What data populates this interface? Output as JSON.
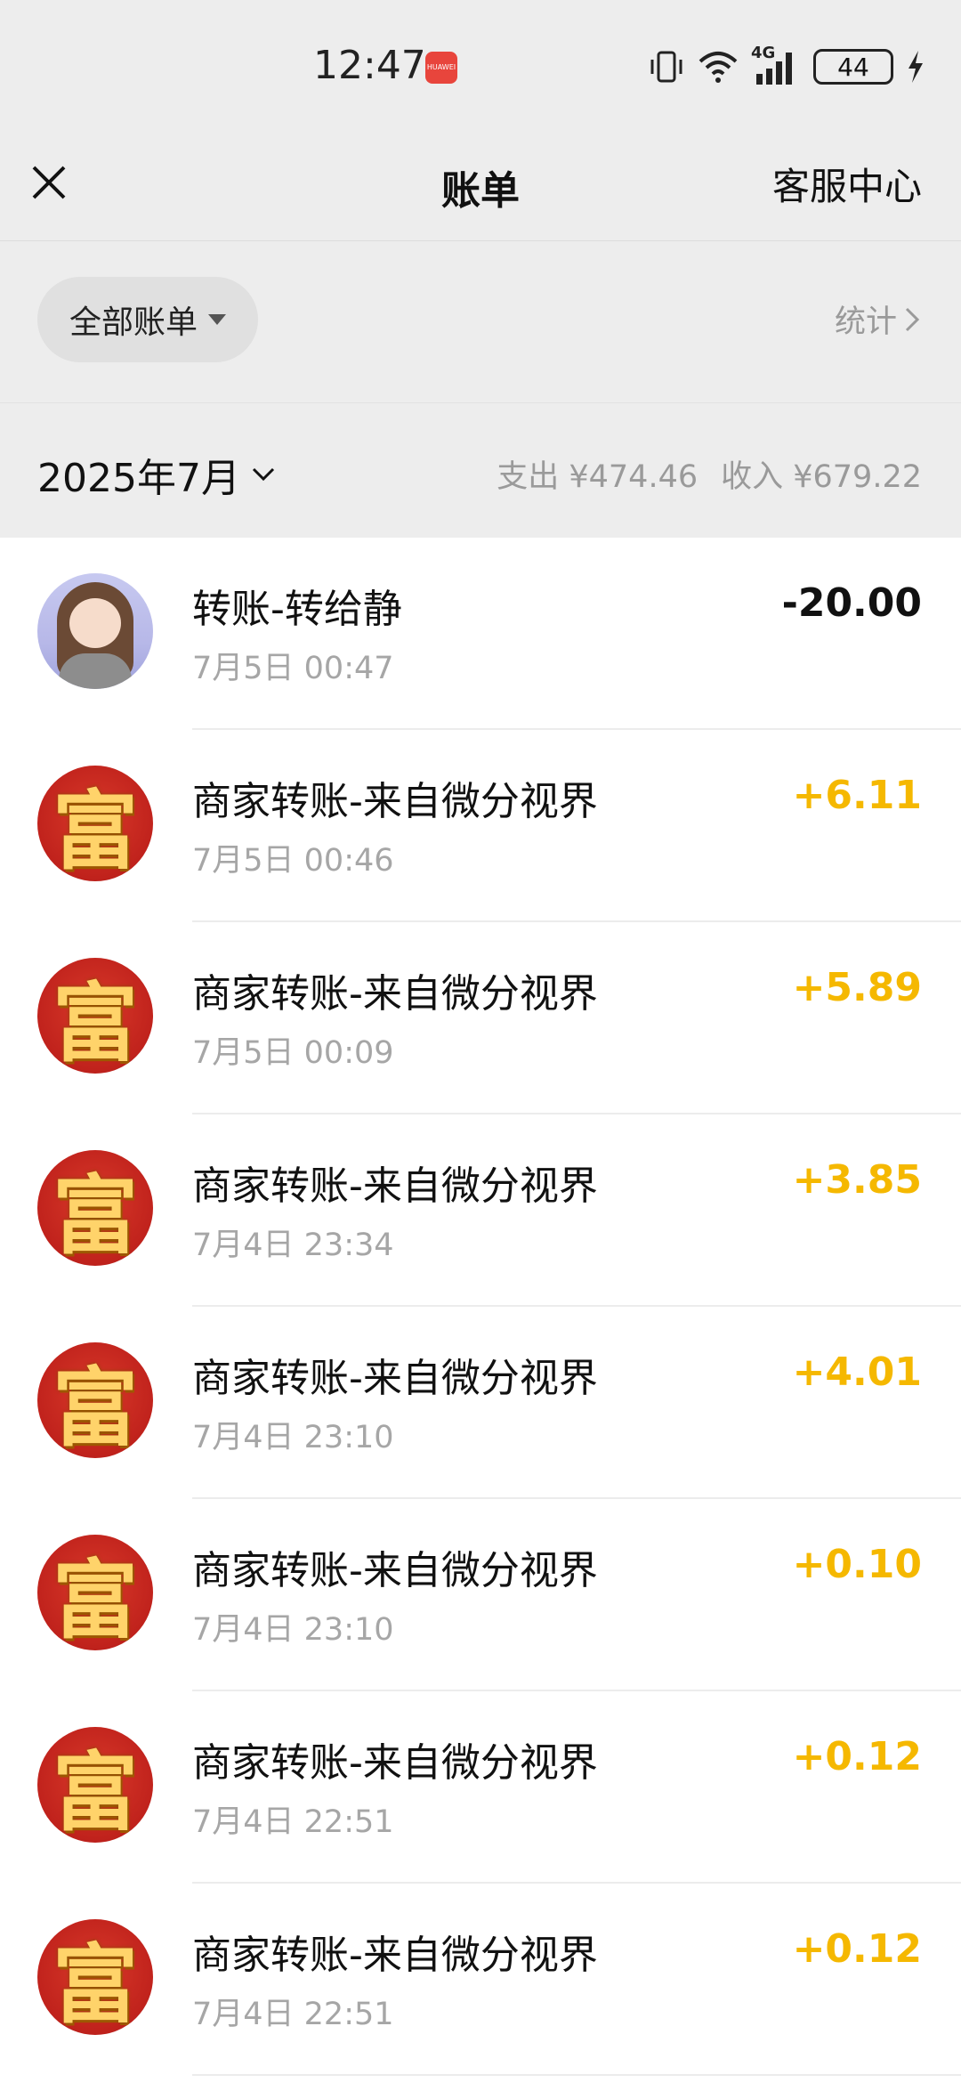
{
  "status_bar": {
    "time": "12:47",
    "badge_text": "HUAWEI",
    "network": "4G",
    "battery": "44"
  },
  "nav": {
    "title": "账单",
    "right_link": "客服中心"
  },
  "filter": {
    "pill_label": "全部账单",
    "stats_label": "统计"
  },
  "month_bar": {
    "month": "2025年7月",
    "expense": "支出 ¥474.46",
    "income": "收入 ¥679.22"
  },
  "transactions": [
    {
      "title": "转账-转给静",
      "date": "7月5日 00:47",
      "amount": "-20.00",
      "type": "expense",
      "avatar": "girl"
    },
    {
      "title": "商家转账-来自微分视界",
      "date": "7月5日 00:46",
      "amount": "+6.11",
      "type": "income",
      "avatar": "fu"
    },
    {
      "title": "商家转账-来自微分视界",
      "date": "7月5日 00:09",
      "amount": "+5.89",
      "type": "income",
      "avatar": "fu"
    },
    {
      "title": "商家转账-来自微分视界",
      "date": "7月4日 23:34",
      "amount": "+3.85",
      "type": "income",
      "avatar": "fu"
    },
    {
      "title": "商家转账-来自微分视界",
      "date": "7月4日 23:10",
      "amount": "+4.01",
      "type": "income",
      "avatar": "fu"
    },
    {
      "title": "商家转账-来自微分视界",
      "date": "7月4日 23:10",
      "amount": "+0.10",
      "type": "income",
      "avatar": "fu"
    },
    {
      "title": "商家转账-来自微分视界",
      "date": "7月4日 22:51",
      "amount": "+0.12",
      "type": "income",
      "avatar": "fu"
    },
    {
      "title": "商家转账-来自微分视界",
      "date": "7月4日 22:51",
      "amount": "+0.12",
      "type": "income",
      "avatar": "fu"
    }
  ],
  "avatar_glyph": "富",
  "colors": {
    "background": "#ededed",
    "income": "#f5b800",
    "expense": "#111111",
    "muted": "#a6a6a6"
  }
}
